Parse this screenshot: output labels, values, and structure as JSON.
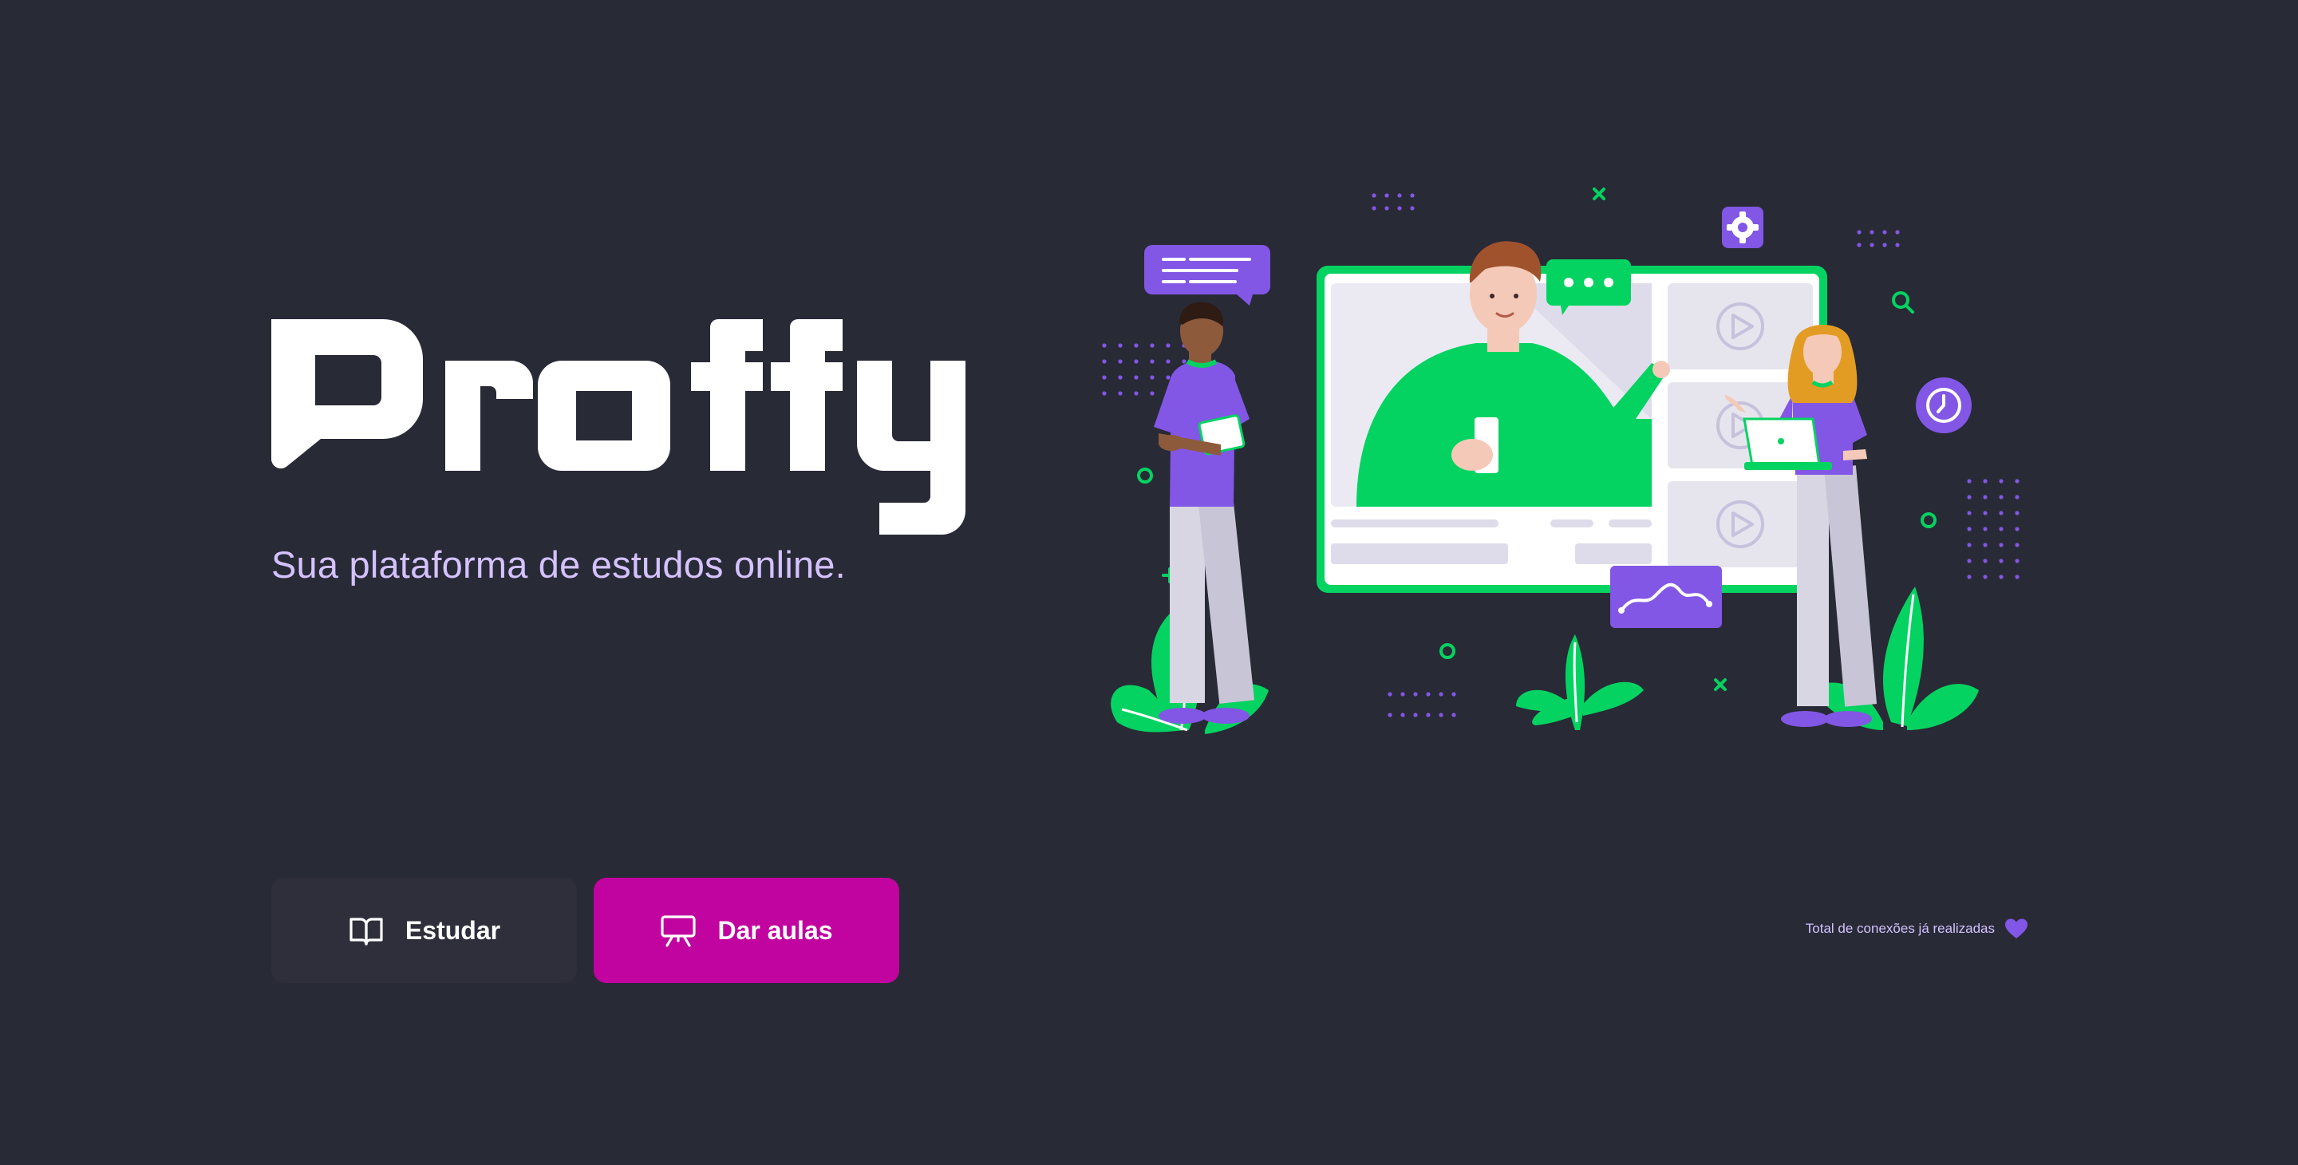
{
  "brand": {
    "name": "Proffy",
    "tagline": "Sua plataforma de estudos online."
  },
  "colors": {
    "background": "#282A36",
    "tagline": "#D4C2FF",
    "study_button": "#2E2F3A",
    "teach_button": "#C1039F",
    "green": "#04D361",
    "purple": "#8257E5"
  },
  "buttons": {
    "study_label": "Estudar",
    "study_icon": "open-book-icon",
    "teach_label": "Dar aulas",
    "teach_icon": "presentation-board-icon"
  },
  "footer": {
    "connections_text": "Total de conexões já realizadas",
    "connections_icon": "heart-icon"
  }
}
